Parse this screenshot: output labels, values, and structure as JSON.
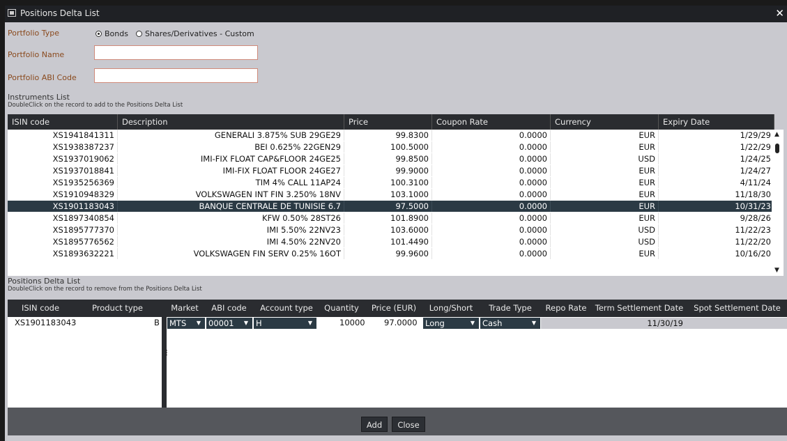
{
  "window": {
    "title": "Positions Delta List",
    "close_label": "✕"
  },
  "form": {
    "portfolio_type_label": "Portfolio Type",
    "radio_bonds": "Bonds",
    "radio_shares": "Shares/Derivatives - Custom",
    "selected_type": "Bonds",
    "portfolio_name_label": "Portfolio Name",
    "portfolio_name_value": "",
    "portfolio_abi_label": "Portfolio ABI Code",
    "portfolio_abi_value": ""
  },
  "instruments": {
    "title": "Instruments List",
    "hint": "DoubleClick on the record to add to the Positions Delta List",
    "columns": [
      "ISIN code",
      "Description",
      "Price",
      "Coupon Rate",
      "Currency",
      "Expiry Date"
    ],
    "rows": [
      {
        "isin": "XS1941841311",
        "desc": "GENERALI 3.875% SUB 29GE29",
        "price": "99.8300",
        "coupon": "0.0000",
        "cur": "EUR",
        "expiry": "1/29/29"
      },
      {
        "isin": "XS1938387237",
        "desc": "BEI 0.625% 22GEN29",
        "price": "100.5000",
        "coupon": "0.0000",
        "cur": "EUR",
        "expiry": "1/22/29"
      },
      {
        "isin": "XS1937019062",
        "desc": "IMI-FIX FLOAT CAP&FLOOR 24GE25",
        "price": "99.8500",
        "coupon": "0.0000",
        "cur": "USD",
        "expiry": "1/24/25"
      },
      {
        "isin": "XS1937018841",
        "desc": "IMI-FIX FLOAT FLOOR 24GE27",
        "price": "99.9000",
        "coupon": "0.0000",
        "cur": "EUR",
        "expiry": "1/24/27"
      },
      {
        "isin": "XS1935256369",
        "desc": "TIM 4% CALL 11AP24",
        "price": "100.3100",
        "coupon": "0.0000",
        "cur": "EUR",
        "expiry": "4/11/24"
      },
      {
        "isin": "XS1910948329",
        "desc": "VOLKSWAGEN INT FIN 3.250% 18NV",
        "price": "103.1000",
        "coupon": "0.0000",
        "cur": "EUR",
        "expiry": "11/18/30"
      },
      {
        "isin": "XS1901183043",
        "desc": "BANQUE CENTRALE DE TUNISIE 6.7",
        "price": "97.5000",
        "coupon": "0.0000",
        "cur": "EUR",
        "expiry": "10/31/23",
        "selected": true
      },
      {
        "isin": "XS1897340854",
        "desc": "KFW 0.50% 28ST26",
        "price": "101.8900",
        "coupon": "0.0000",
        "cur": "EUR",
        "expiry": "9/28/26"
      },
      {
        "isin": "XS1895777370",
        "desc": "IMI 5.50% 22NV23",
        "price": "103.6000",
        "coupon": "0.0000",
        "cur": "USD",
        "expiry": "11/22/23"
      },
      {
        "isin": "XS1895776562",
        "desc": "IMI 4.50% 22NV20",
        "price": "101.4490",
        "coupon": "0.0000",
        "cur": "USD",
        "expiry": "11/22/20"
      },
      {
        "isin": "XS1893632221",
        "desc": "VOLKSWAGEN FIN SERV 0.25% 16OT",
        "price": "99.9600",
        "coupon": "0.0000",
        "cur": "EUR",
        "expiry": "10/16/20"
      }
    ]
  },
  "positions": {
    "title": "Positions Delta List",
    "hint": "DoubleClick on the record to remove from the Positions Delta List",
    "columns": [
      "ISIN code",
      "Product type",
      "Market",
      "ABI code",
      "Account type",
      "Quantity",
      "Price (EUR)",
      "Long/Short",
      "Trade Type",
      "Repo Rate",
      "Term Settlement Date",
      "Spot Settlement Date"
    ],
    "row": {
      "isin": "XS1901183043",
      "product_type": "B",
      "market": "MTS",
      "abi_code": "00001",
      "account_type": "H",
      "quantity": "10000",
      "price": "97.0000",
      "long_short": "Long",
      "trade_type": "Cash",
      "repo_rate": "",
      "term_settlement": "11/30/19",
      "spot_settlement": ""
    }
  },
  "buttons": {
    "add": "Add",
    "close": "Close"
  },
  "colors": {
    "title_bar": "#1f2125",
    "selected_row": "#2b3a44",
    "label": "#8a4a1e"
  }
}
